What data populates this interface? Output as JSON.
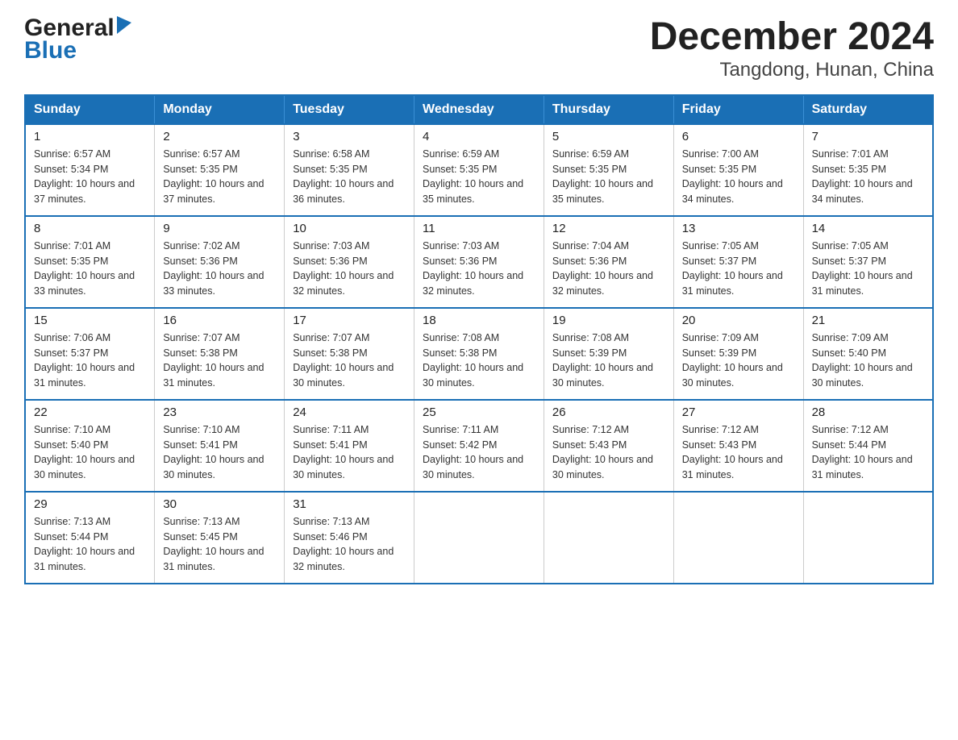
{
  "header": {
    "logo_general": "General",
    "logo_blue": "Blue",
    "title": "December 2024",
    "subtitle": "Tangdong, Hunan, China"
  },
  "calendar": {
    "days": [
      "Sunday",
      "Monday",
      "Tuesday",
      "Wednesday",
      "Thursday",
      "Friday",
      "Saturday"
    ],
    "weeks": [
      [
        {
          "day": "1",
          "sunrise": "6:57 AM",
          "sunset": "5:34 PM",
          "daylight": "10 hours and 37 minutes."
        },
        {
          "day": "2",
          "sunrise": "6:57 AM",
          "sunset": "5:35 PM",
          "daylight": "10 hours and 37 minutes."
        },
        {
          "day": "3",
          "sunrise": "6:58 AM",
          "sunset": "5:35 PM",
          "daylight": "10 hours and 36 minutes."
        },
        {
          "day": "4",
          "sunrise": "6:59 AM",
          "sunset": "5:35 PM",
          "daylight": "10 hours and 35 minutes."
        },
        {
          "day": "5",
          "sunrise": "6:59 AM",
          "sunset": "5:35 PM",
          "daylight": "10 hours and 35 minutes."
        },
        {
          "day": "6",
          "sunrise": "7:00 AM",
          "sunset": "5:35 PM",
          "daylight": "10 hours and 34 minutes."
        },
        {
          "day": "7",
          "sunrise": "7:01 AM",
          "sunset": "5:35 PM",
          "daylight": "10 hours and 34 minutes."
        }
      ],
      [
        {
          "day": "8",
          "sunrise": "7:01 AM",
          "sunset": "5:35 PM",
          "daylight": "10 hours and 33 minutes."
        },
        {
          "day": "9",
          "sunrise": "7:02 AM",
          "sunset": "5:36 PM",
          "daylight": "10 hours and 33 minutes."
        },
        {
          "day": "10",
          "sunrise": "7:03 AM",
          "sunset": "5:36 PM",
          "daylight": "10 hours and 32 minutes."
        },
        {
          "day": "11",
          "sunrise": "7:03 AM",
          "sunset": "5:36 PM",
          "daylight": "10 hours and 32 minutes."
        },
        {
          "day": "12",
          "sunrise": "7:04 AM",
          "sunset": "5:36 PM",
          "daylight": "10 hours and 32 minutes."
        },
        {
          "day": "13",
          "sunrise": "7:05 AM",
          "sunset": "5:37 PM",
          "daylight": "10 hours and 31 minutes."
        },
        {
          "day": "14",
          "sunrise": "7:05 AM",
          "sunset": "5:37 PM",
          "daylight": "10 hours and 31 minutes."
        }
      ],
      [
        {
          "day": "15",
          "sunrise": "7:06 AM",
          "sunset": "5:37 PM",
          "daylight": "10 hours and 31 minutes."
        },
        {
          "day": "16",
          "sunrise": "7:07 AM",
          "sunset": "5:38 PM",
          "daylight": "10 hours and 31 minutes."
        },
        {
          "day": "17",
          "sunrise": "7:07 AM",
          "sunset": "5:38 PM",
          "daylight": "10 hours and 30 minutes."
        },
        {
          "day": "18",
          "sunrise": "7:08 AM",
          "sunset": "5:38 PM",
          "daylight": "10 hours and 30 minutes."
        },
        {
          "day": "19",
          "sunrise": "7:08 AM",
          "sunset": "5:39 PM",
          "daylight": "10 hours and 30 minutes."
        },
        {
          "day": "20",
          "sunrise": "7:09 AM",
          "sunset": "5:39 PM",
          "daylight": "10 hours and 30 minutes."
        },
        {
          "day": "21",
          "sunrise": "7:09 AM",
          "sunset": "5:40 PM",
          "daylight": "10 hours and 30 minutes."
        }
      ],
      [
        {
          "day": "22",
          "sunrise": "7:10 AM",
          "sunset": "5:40 PM",
          "daylight": "10 hours and 30 minutes."
        },
        {
          "day": "23",
          "sunrise": "7:10 AM",
          "sunset": "5:41 PM",
          "daylight": "10 hours and 30 minutes."
        },
        {
          "day": "24",
          "sunrise": "7:11 AM",
          "sunset": "5:41 PM",
          "daylight": "10 hours and 30 minutes."
        },
        {
          "day": "25",
          "sunrise": "7:11 AM",
          "sunset": "5:42 PM",
          "daylight": "10 hours and 30 minutes."
        },
        {
          "day": "26",
          "sunrise": "7:12 AM",
          "sunset": "5:43 PM",
          "daylight": "10 hours and 30 minutes."
        },
        {
          "day": "27",
          "sunrise": "7:12 AM",
          "sunset": "5:43 PM",
          "daylight": "10 hours and 31 minutes."
        },
        {
          "day": "28",
          "sunrise": "7:12 AM",
          "sunset": "5:44 PM",
          "daylight": "10 hours and 31 minutes."
        }
      ],
      [
        {
          "day": "29",
          "sunrise": "7:13 AM",
          "sunset": "5:44 PM",
          "daylight": "10 hours and 31 minutes."
        },
        {
          "day": "30",
          "sunrise": "7:13 AM",
          "sunset": "5:45 PM",
          "daylight": "10 hours and 31 minutes."
        },
        {
          "day": "31",
          "sunrise": "7:13 AM",
          "sunset": "5:46 PM",
          "daylight": "10 hours and 32 minutes."
        },
        null,
        null,
        null,
        null
      ]
    ]
  }
}
